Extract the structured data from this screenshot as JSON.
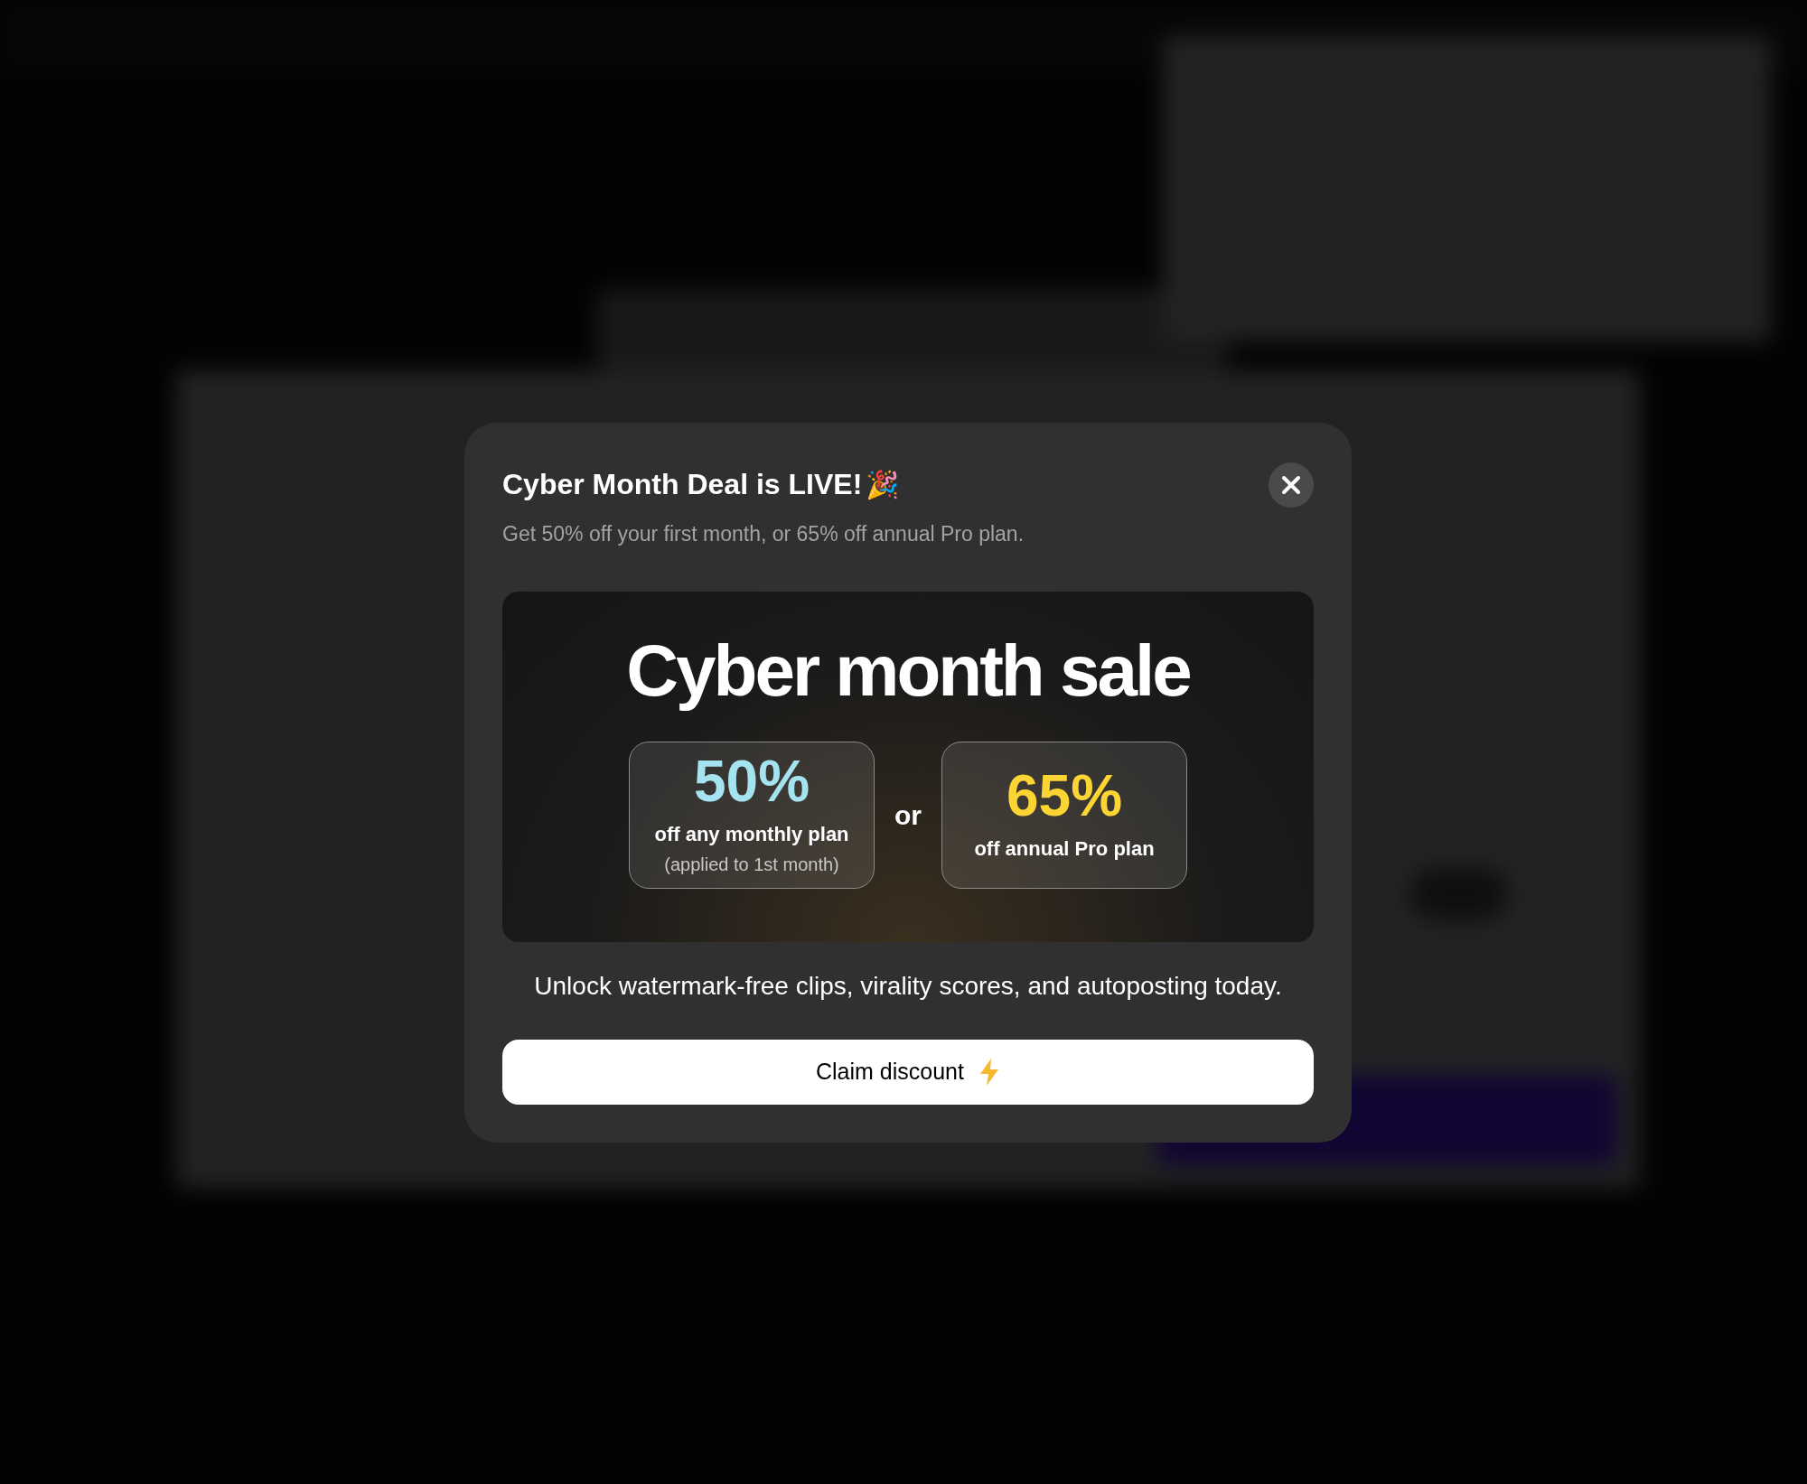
{
  "dialog": {
    "title": "Cyber Month Deal is LIVE!",
    "title_emoji": "🎉",
    "subtitle": "Get 50% off your first month, or 65% off annual Pro plan.",
    "banner": {
      "headline": "Cyber month sale",
      "separator": "or",
      "offers": [
        {
          "percent": "50%",
          "color": "#a5e3f0",
          "lines": [
            "off any monthly plan",
            "(applied to 1st month)"
          ]
        },
        {
          "percent": "65%",
          "color": "#fcd535",
          "lines": [
            "off annual Pro plan"
          ]
        }
      ]
    },
    "description": "Unlock watermark-free clips, virality scores, and autoposting today.",
    "button": {
      "label": "Claim discount"
    }
  }
}
